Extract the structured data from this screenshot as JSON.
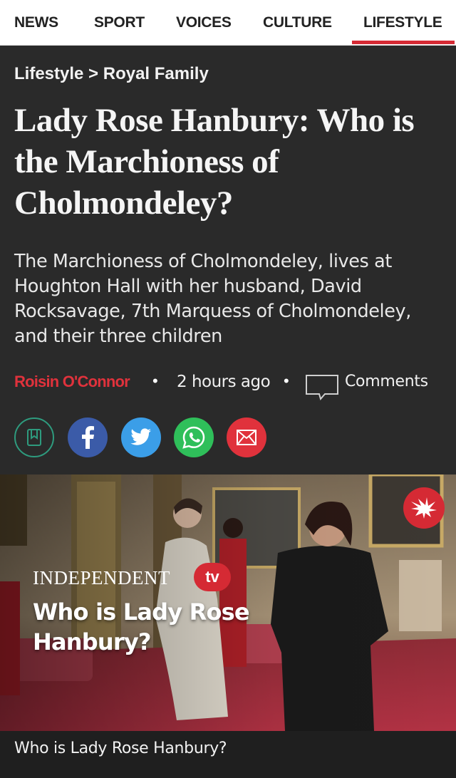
{
  "nav": {
    "items": [
      "NEWS",
      "SPORT",
      "VOICES",
      "CULTURE",
      "LIFESTYLE"
    ],
    "active": "LIFESTYLE",
    "accent": "#d52a34"
  },
  "breadcrumb": {
    "section": "Lifestyle",
    "separator": ">",
    "subsection": "Royal Family"
  },
  "article": {
    "headline": "Lady Rose Hanbury: Who is the Marchioness of Cholmondeley?",
    "standfirst": "The Marchioness of Cholmondeley, lives at Houghton Hall with her husband, David Rocksavage, 7th Marquess of Cholmondeley, and their three children",
    "author": "Roisin O'Connor",
    "separator_dot": "•",
    "time": "2 hours ago",
    "comments_label": "Comments"
  },
  "share": {
    "icons": [
      "bookmark-icon",
      "facebook-icon",
      "twitter-icon",
      "whatsapp-icon",
      "email-icon"
    ],
    "colors": {
      "bookmark": "#2e2e2e",
      "facebook": "#3b5ba8",
      "twitter": "#3b9ee8",
      "whatsapp": "#2fbf5a",
      "email": "#e0323c"
    }
  },
  "video": {
    "brand": "INDEPENDENT",
    "badge": "tv",
    "title": "Who is Lady Rose Hanbury?",
    "caption": "Who is Lady Rose Hanbury?"
  }
}
